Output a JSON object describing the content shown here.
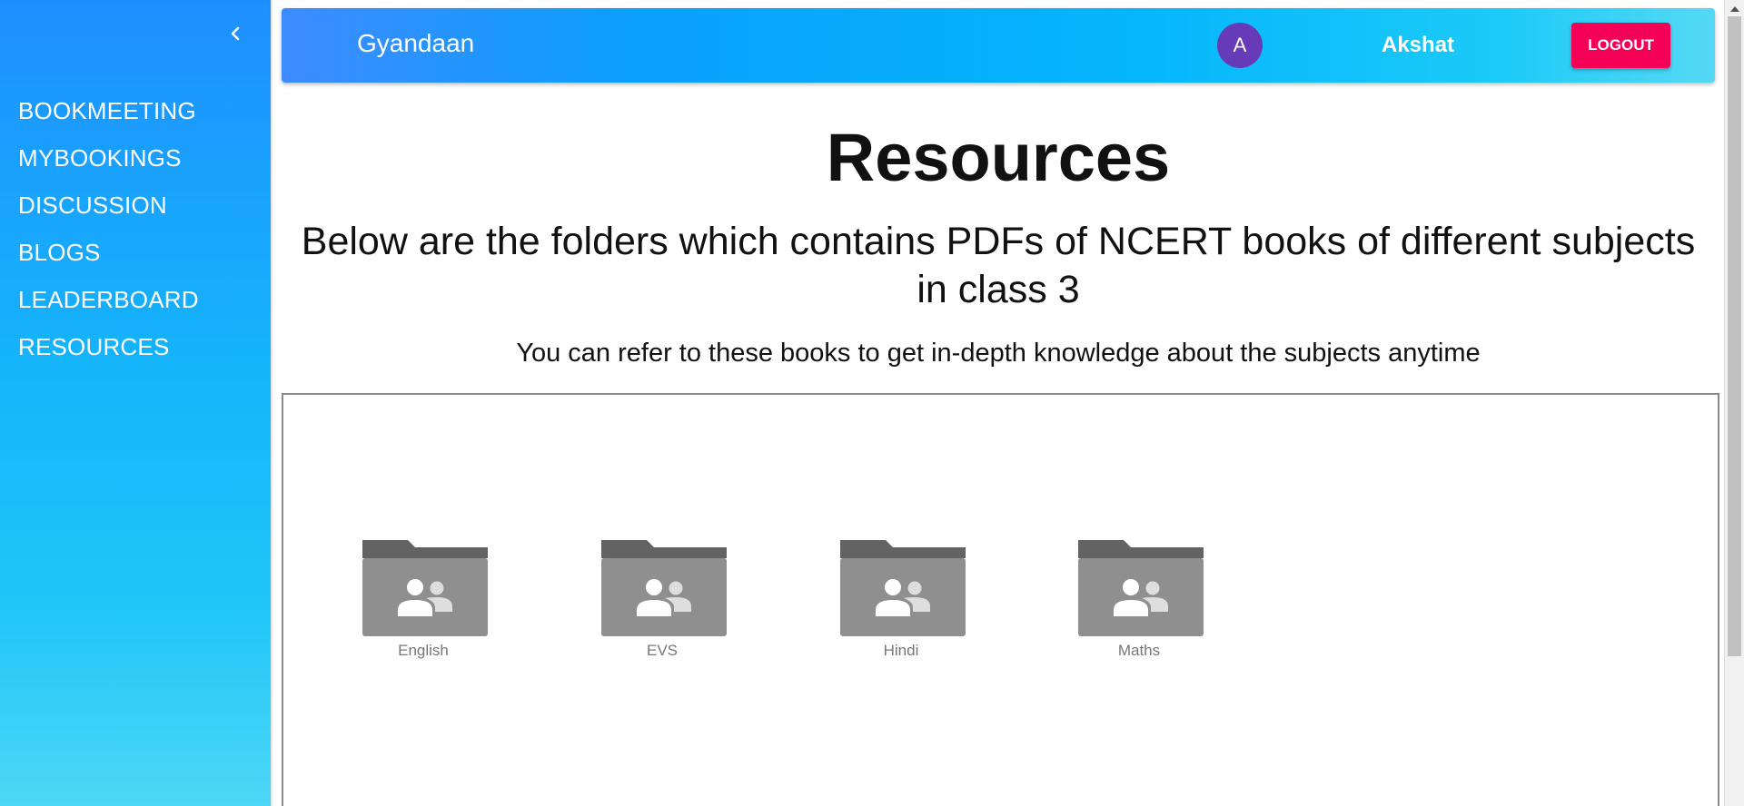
{
  "sidebar": {
    "collapse_icon": "chevron-left-icon",
    "items": [
      {
        "label": "BOOKMEETING"
      },
      {
        "label": "MYBOOKINGS"
      },
      {
        "label": "DISCUSSION"
      },
      {
        "label": "BLOGS"
      },
      {
        "label": "LEADERBOARD"
      },
      {
        "label": "RESOURCES"
      }
    ]
  },
  "header": {
    "brand": "Gyandaan",
    "avatar_initial": "A",
    "username": "Akshat",
    "logout_label": "LOGOUT"
  },
  "main": {
    "title": "Resources",
    "subtitle": "Below are the folders which contains PDFs of NCERT books of different subjects in class 3",
    "description": "You can refer to these books to get in-depth knowledge about the subjects anytime",
    "folder_icon": "shared-folder-icon",
    "folders": [
      {
        "label": "English"
      },
      {
        "label": "EVS"
      },
      {
        "label": "Hindi"
      },
      {
        "label": "Maths"
      }
    ]
  },
  "colors": {
    "sidebar_gradient_top": "#1e8fff",
    "sidebar_gradient_bottom": "#4dd7f6",
    "appbar_gradient_start": "#3d8bff",
    "appbar_gradient_end": "#55d9f5",
    "avatar": "#673ab7",
    "logout": "#f50057",
    "folder": "#8f8f8f"
  }
}
